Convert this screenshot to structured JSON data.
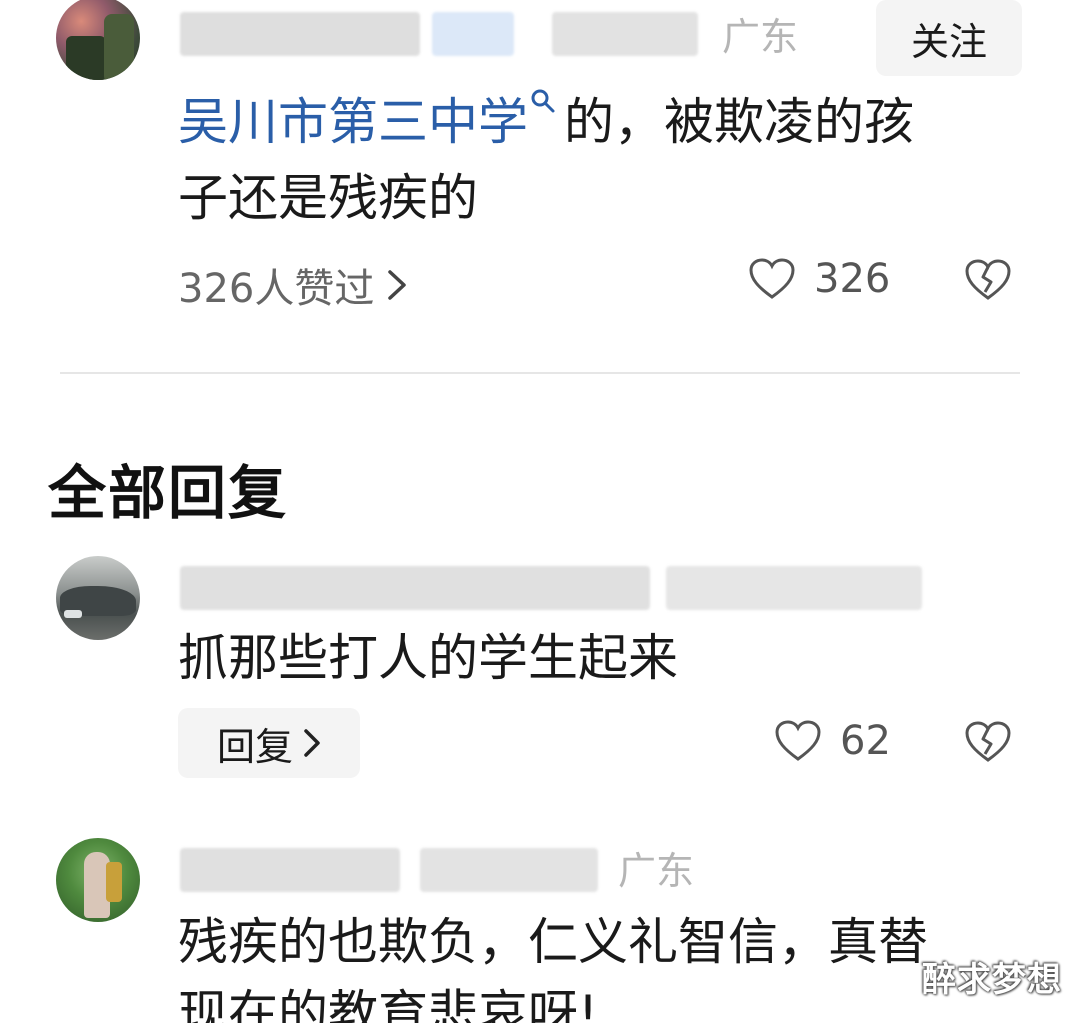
{
  "top_comment": {
    "location": "广东",
    "follow_label": "关注",
    "text_link": "吴川市第三中学",
    "text_line1_rest": "的，被欺凌的孩",
    "text_line2": "子还是残疾的",
    "liked_by_label": "326人赞过",
    "like_count": "326"
  },
  "section_title": "全部回复",
  "replies": [
    {
      "text": "抓那些打人的学生起来",
      "reply_label": "回复",
      "like_count": "62"
    },
    {
      "location": "广东",
      "text_line1": "残疾的也欺负，仁义礼智信，真替",
      "text_line2": "现在的教育悲哀呀!"
    }
  ],
  "watermark": "醉求梦想",
  "colors": {
    "link": "#2a5ea8",
    "muted": "#b5b5b5",
    "button_bg": "#f4f4f4",
    "divider": "#e6e6e6"
  },
  "icons": [
    "search-icon",
    "chevron-right-icon",
    "heart-icon",
    "broken-heart-icon"
  ]
}
